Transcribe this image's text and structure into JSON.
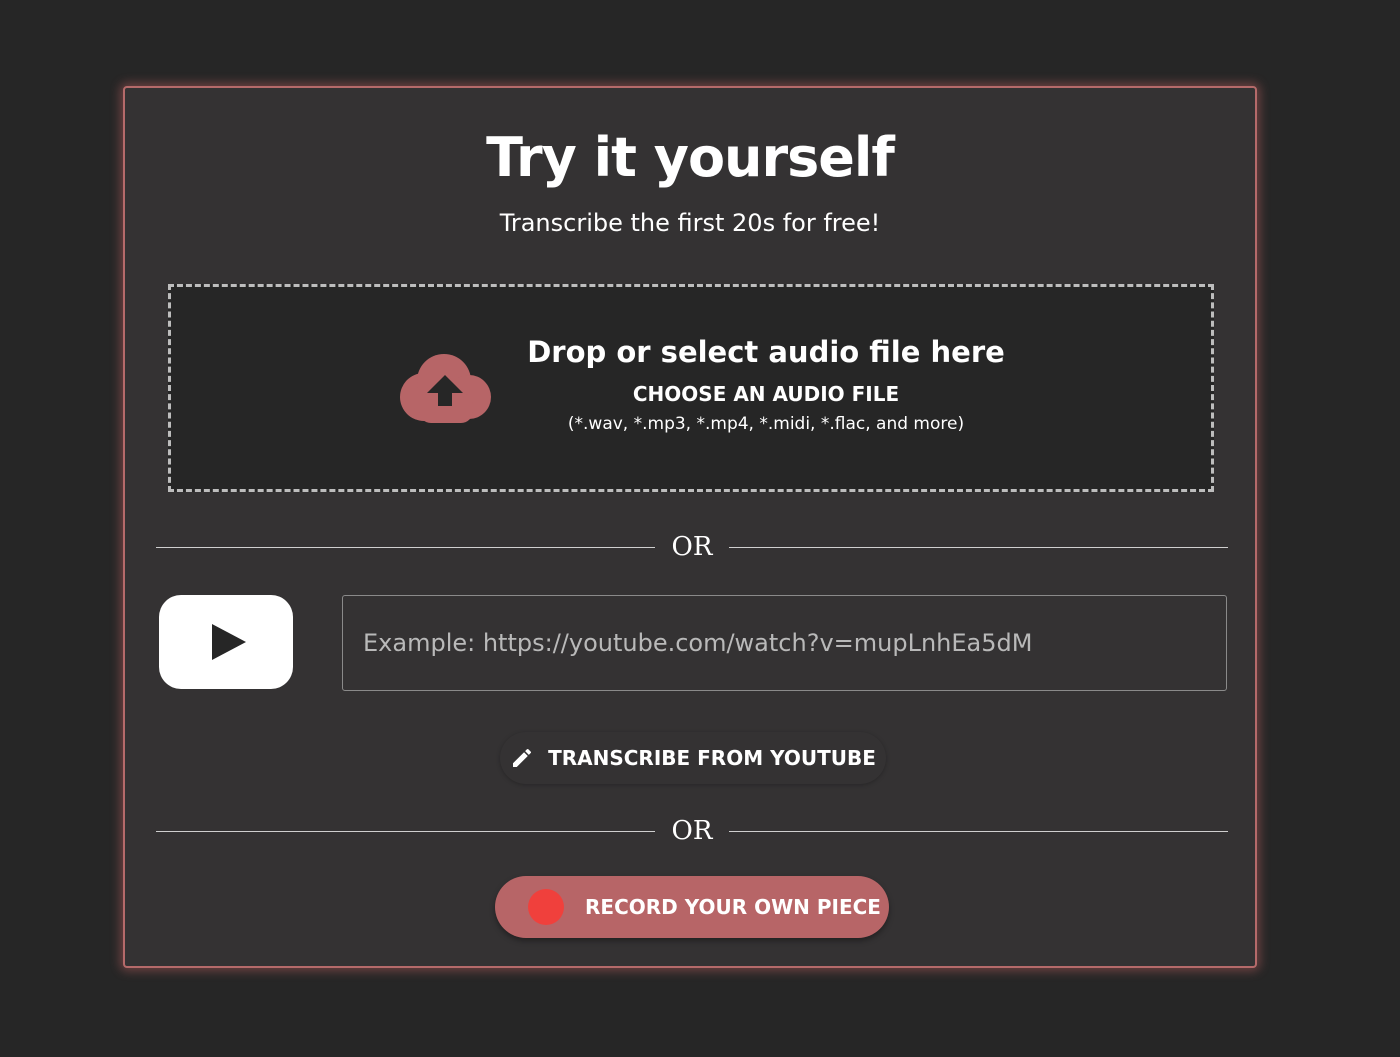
{
  "colors": {
    "page_background": "#262626",
    "card_background": "#343233",
    "accent": "#b76567",
    "record_dot": "#f0403c"
  },
  "header": {
    "title": "Try it yourself",
    "subtitle": "Transcribe the first 20s for free!"
  },
  "upload": {
    "icon": "cloud-upload-icon",
    "main_text": "Drop or select audio file here",
    "choose_label": "CHOOSE AN AUDIO FILE",
    "formats": "(*.wav, *.mp3, *.mp4, *.midi, *.flac, and more)"
  },
  "dividers": {
    "or_text": "OR"
  },
  "youtube": {
    "icon": "youtube-logo-icon",
    "input_placeholder": "Example: https://youtube.com/watch?v=mupLnhEa5dM",
    "input_value": "",
    "button_icon": "pencil-icon",
    "button_label": "TRANSCRIBE FROM YOUTUBE"
  },
  "record": {
    "icon": "record-dot-icon",
    "button_label": "RECORD YOUR OWN PIECE"
  }
}
